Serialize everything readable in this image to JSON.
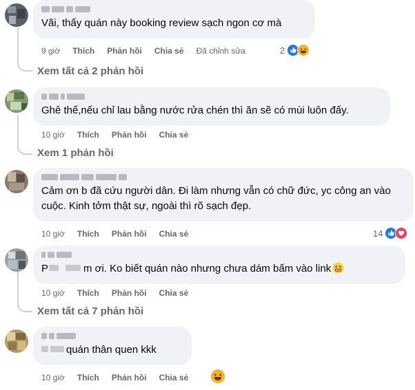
{
  "comments": [
    {
      "text": "Vãi, thấy quán này booking review sạch ngon cơ mà",
      "time": "9 giờ",
      "like": "Thích",
      "reply": "Phản hồi",
      "share": "Chia sẻ",
      "edited": "Đã chỉnh sửa",
      "reaction_count": "2",
      "reactions": [
        "like-icon",
        "haha-icon"
      ],
      "view_replies": "Xem tất cả 2 phản hồi"
    },
    {
      "text": "Ghê thế,nếu chỉ lau bằng nước rửa chén thì ăn sẽ có mùi luôn đấy.",
      "time": "10 giờ",
      "like": "Thích",
      "reply": "Phản hồi",
      "share": "Chia sẻ",
      "view_replies": "Xem 1 phản hồi"
    },
    {
      "text": "Cảm ơn b đã cứu người dân. Đi làm nhưng vẫn có chữ đức, yc công an vào cuộc. Kinh tởm thật sự, ngoài thì rõ sạch đẹp.",
      "time": "10 giờ",
      "like": "Thích",
      "reply": "Phản hồi",
      "share": "Chia sẻ",
      "reaction_count": "14",
      "reactions": [
        "like-icon",
        "love-icon"
      ]
    },
    {
      "text_prefix": "P",
      "text": "m ơi. Ko biết quán nào nhưng chưa dám bấm vào link",
      "time": "10 giờ",
      "like": "Thích",
      "reply": "Phản hồi",
      "share": "Chia sẻ",
      "inline_emoji": "grimace-emoji",
      "view_replies": "Xem tất cả 7 phản hồi"
    },
    {
      "text": "quán thân quen kkk",
      "time": "10 giờ",
      "like": "Thích",
      "reply": "Phản hồi",
      "share": "Chia sẻ",
      "reactions": [
        "haha-icon"
      ]
    }
  ],
  "colors": {
    "bubble": "#f0f2f5",
    "meta": "#65676b",
    "text": "#050505",
    "like_blue": "#1877f2",
    "love_red": "#f33e58",
    "haha_yellow": "#f7b125"
  }
}
